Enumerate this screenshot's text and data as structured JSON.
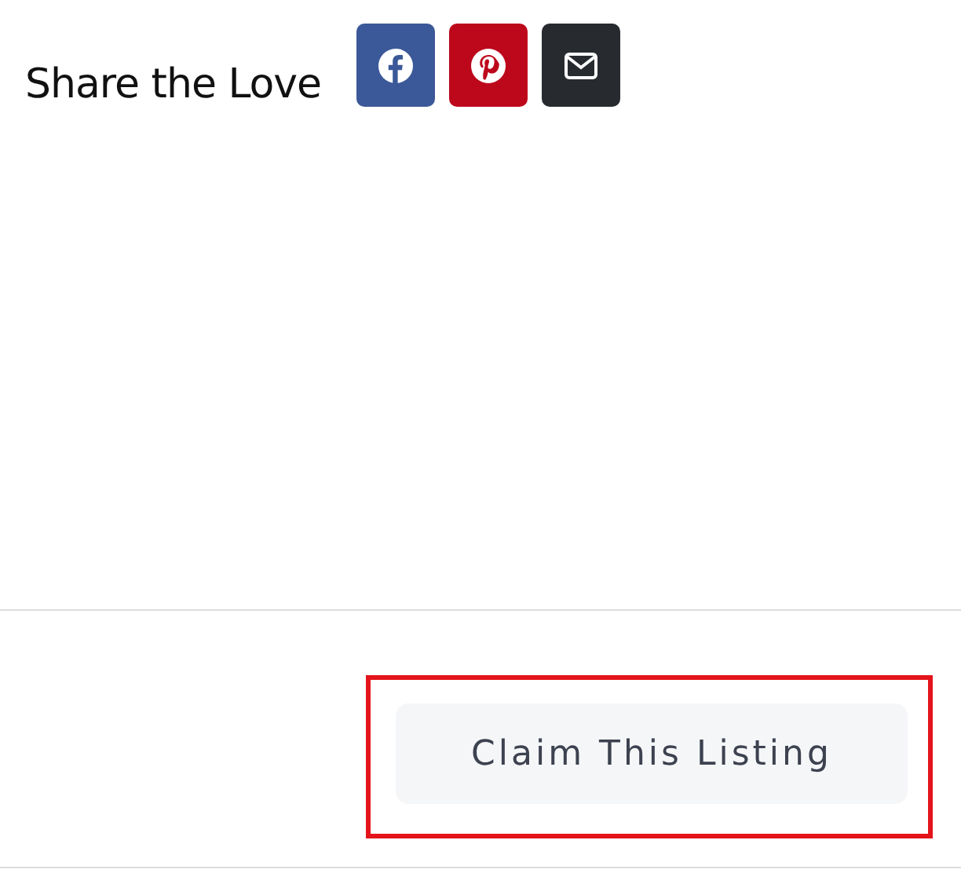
{
  "share": {
    "label": "Share the Love",
    "buttons": [
      {
        "kind": "facebook",
        "color": "#3b5998"
      },
      {
        "kind": "pinterest",
        "color": "#bd081c"
      },
      {
        "kind": "email",
        "color": "#272b30"
      }
    ]
  },
  "claim_button": {
    "label": "Claim This Listing",
    "highlighted": true
  }
}
